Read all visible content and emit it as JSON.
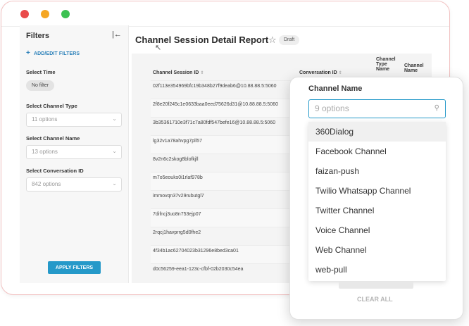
{
  "sidebar": {
    "title": "Filters",
    "add_edit": "ADD/EDIT FILTERS",
    "filters": [
      {
        "label": "Select Time",
        "chip": "No filter"
      },
      {
        "label": "Select Channel Type",
        "placeholder": "11 options"
      },
      {
        "label": "Select Channel Name",
        "placeholder": "13 options"
      },
      {
        "label": "Select Conversation ID",
        "placeholder": "842 options"
      }
    ],
    "apply_label": "APPLY FILTERS"
  },
  "report": {
    "title": "Channel Session Detail Report",
    "badge": "Draft",
    "columns": [
      "Channel Session ID",
      "Conversation ID",
      "Channel Type Name",
      "Channel Name"
    ],
    "rows": [
      "02f113e354969bfc19b348b27f9deab6@10.88.88.5:5060",
      "2f8e20f245c1e0633baa0eed75626d31@10.88.88.5:5060",
      "3b35361710e3f71c7a80fdf547befe16@10.88.88.5:5060",
      "lg32v1a78ahvpg7pll57",
      "8v2n6c2skog8blofkjll",
      "m7o5eouks0i1rlaf978b",
      "immovqn37v29rubutgl7",
      "7difncj3uo8n753ejp07",
      "2rqcj1havprrg5d0fhe2",
      "4f34b1ac62704023b31296e8bed3ca01",
      "d0c56259-eea1-123c-cfbf-02b2030c54ea"
    ]
  },
  "dropdown": {
    "title": "Channel Name",
    "search_placeholder": "9 options",
    "options": [
      "360Dialog",
      "Facebook Channel",
      "faizan-push",
      "Twilio Whatsapp Channel",
      "Twitter Channel",
      "Voice Channel",
      "Web Channel",
      "web-pull"
    ],
    "active_index": 0,
    "clear_label": "CLEAR ALL"
  },
  "icons": {
    "collapse": "collapse-left-icon",
    "add": "plus-icon",
    "star": "star-icon",
    "search": "search-icon",
    "chevron": "chevron-down-icon",
    "sort": "sort-icon",
    "cursor": "mouse-cursor-icon"
  },
  "colors": {
    "accent": "#2599c9",
    "window_close": "#e94b4b",
    "window_minimize": "#f5a623",
    "window_maximize": "#3cc152"
  }
}
